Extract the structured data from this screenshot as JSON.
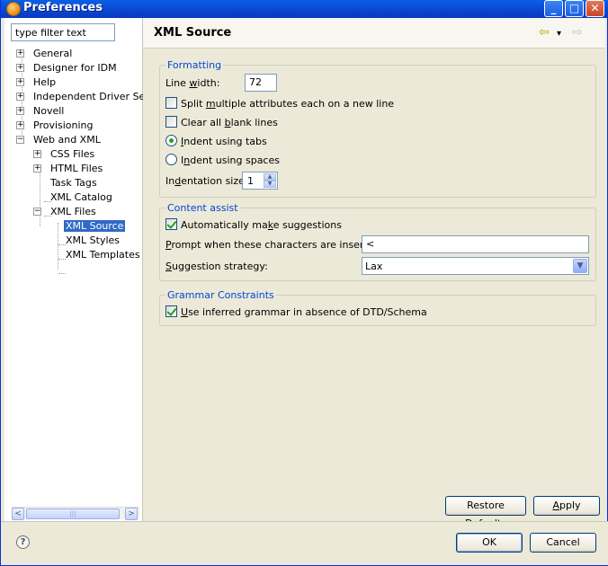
{
  "window": {
    "title": "Preferences",
    "minimize": "_",
    "maximize": "□",
    "close": "✕"
  },
  "filter": {
    "placeholder": "type filter text",
    "value": "type filter text"
  },
  "tree": [
    {
      "label": "General",
      "toggle": "+"
    },
    {
      "label": "Designer for IDM",
      "toggle": "+"
    },
    {
      "label": "Help",
      "toggle": "+"
    },
    {
      "label": "Independent Driver Serv",
      "toggle": "+"
    },
    {
      "label": "Novell",
      "toggle": "+"
    },
    {
      "label": "Provisioning",
      "toggle": "+"
    },
    {
      "label": "Web and XML",
      "toggle": "−"
    },
    {
      "label": "CSS Files",
      "toggle": "+"
    },
    {
      "label": "HTML Files",
      "toggle": "+"
    },
    {
      "label": "Task Tags",
      "toggle": ""
    },
    {
      "label": "XML Catalog",
      "toggle": ""
    },
    {
      "label": "XML Files",
      "toggle": "−"
    },
    {
      "label": "XML Source",
      "toggle": ""
    },
    {
      "label": "XML Styles",
      "toggle": ""
    },
    {
      "label": "XML Templates",
      "toggle": ""
    }
  ],
  "scroll": {
    "left": "<",
    "right": ">",
    "grip": "|||"
  },
  "page": {
    "title": "XML Source",
    "back": "⇦",
    "menu": "▾",
    "forward": "⇨"
  },
  "formatting": {
    "legend": "Formatting",
    "line_width_label_pre": "Line ",
    "line_width_label_mn": "w",
    "line_width_label_post": "idth:",
    "line_width_value": "72",
    "split_pre": "Split ",
    "split_mn": "m",
    "split_post": "ultiple attributes each on a new line",
    "split_checked": false,
    "clear_pre": "Clear all ",
    "clear_mn": "b",
    "clear_post": "lank lines",
    "clear_checked": false,
    "indent_tabs_pre": "",
    "indent_tabs_mn": "I",
    "indent_tabs_post": "ndent using tabs",
    "indent_spaces_pre": "I",
    "indent_spaces_mn": "n",
    "indent_spaces_post": "dent using spaces",
    "indent_selected": "tabs",
    "indent_size_pre": "In",
    "indent_size_mn": "d",
    "indent_size_post": "entation size:",
    "indent_size_value": "1",
    "spin_up": "▲",
    "spin_down": "▼"
  },
  "content_assist": {
    "legend": "Content assist",
    "auto_pre": "Automatically ma",
    "auto_mn": "k",
    "auto_post": "e suggestions",
    "auto_checked": true,
    "prompt_pre": "",
    "prompt_mn": "P",
    "prompt_post": "rompt when these characters are inserted:",
    "prompt_value": "<",
    "strategy_pre": "",
    "strategy_mn": "S",
    "strategy_post": "uggestion strategy:",
    "strategy_value": "Lax",
    "drop": "▼"
  },
  "grammar": {
    "legend": "Grammar Constraints",
    "use_pre": "",
    "use_mn": "U",
    "use_post": "se inferred grammar in absence of DTD/Schema",
    "use_checked": true
  },
  "buttons": {
    "restore_pre": "Restore ",
    "restore_mn": "D",
    "restore_post": "efaults",
    "apply_pre": "",
    "apply_mn": "A",
    "apply_post": "pply",
    "ok": "OK",
    "cancel": "Cancel",
    "help": "?"
  }
}
